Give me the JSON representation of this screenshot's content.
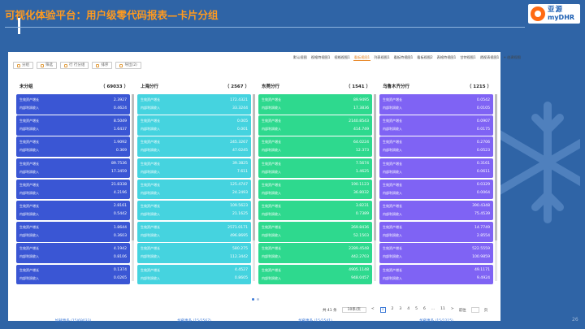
{
  "slide": {
    "title": "可视化体验平台：用户级零代码报表—卡片分组",
    "logo_cn": "亚源",
    "logo_en": "myDHR",
    "page_number": "26"
  },
  "toolbar": {
    "buttons": [
      "分组",
      "筛选",
      "行 行分组",
      "排序",
      "导出(2)"
    ]
  },
  "view_tabs": {
    "items": [
      "默认视图",
      "视格特视图1",
      "视格视图1",
      "看板视图1",
      "列表视图1",
      "看板特视图1",
      "看板视图2",
      "表格特视图1",
      "甘特视图1",
      "透视表视图1",
      "+ 创建视图"
    ],
    "active_index": 3
  },
  "card_labels": {
    "label1": "生效资产增长",
    "label2": "内部利润收入"
  },
  "columns": [
    {
      "title": "未分组",
      "count": "（ 69033 ）",
      "color": "#3a56d4",
      "load_more": "加载更多 (15/69033)",
      "cards": [
        [
          "2.3927",
          "0.4624"
        ],
        [
          "8.5049",
          "1.6437"
        ],
        [
          "1.9092",
          "0.369"
        ],
        [
          "89.7536",
          "17.3459"
        ],
        [
          "21.8338",
          "4.2196"
        ],
        [
          "2.8161",
          "0.5442"
        ],
        [
          "1.8644",
          "0.3603"
        ],
        [
          "4.1942",
          "0.8106"
        ],
        [
          "0.1374",
          "0.0265"
        ]
      ]
    },
    {
      "title": "上海分行",
      "count": "（ 2567 ）",
      "color": "#45d3df",
      "load_more": "加载更多 (15/2567)",
      "cards": [
        [
          "172.4321",
          "33.3244"
        ],
        [
          "0.005",
          "0.001"
        ],
        [
          "245.3267",
          "47.0245"
        ],
        [
          "39.3825",
          "7.611"
        ],
        [
          "125.4747",
          "24.2493"
        ],
        [
          "109.5623",
          "21.1625"
        ],
        [
          "2571.0171",
          "496.8695"
        ],
        [
          "580.275",
          "112.3442"
        ],
        [
          "4.4527",
          "0.8605"
        ]
      ]
    },
    {
      "title": "东莞分行",
      "count": "（ 1541 ）",
      "color": "#2ed98e",
      "load_more": "加载更多 (15/1541)",
      "cards": [
        [
          "89.9495",
          "17.3836"
        ],
        [
          "2140.8543",
          "414.749"
        ],
        [
          "64.0224",
          "12.373"
        ],
        [
          "7.5674",
          "1.4625"
        ],
        [
          "190.1123",
          "36.8032"
        ],
        [
          "3.8231",
          "0.7389"
        ],
        [
          "269.8436",
          "52.1503"
        ],
        [
          "2289.4548",
          "442.2703"
        ],
        [
          "4905.1148",
          "948.0457"
        ]
      ]
    },
    {
      "title": "乌鲁木齐分行",
      "count": "（ 1215 ）",
      "color": "#7f63f4",
      "load_more": "加载更多 (15/1215)",
      "cards": [
        [
          "0.0542",
          "0.0105"
        ],
        [
          "0.0907",
          "0.0175"
        ],
        [
          "0.2706",
          "0.0523"
        ],
        [
          "0.3161",
          "0.0611"
        ],
        [
          "0.0329",
          "0.0064"
        ],
        [
          "390.4348",
          "75.4539"
        ],
        [
          "14.7749",
          "2.8554"
        ],
        [
          "522.5559",
          "100.9859"
        ],
        [
          "49.1171",
          "9.4924"
        ]
      ]
    }
  ],
  "pagination": {
    "total": "共 41 条",
    "page_size": "10条/页",
    "pages": [
      "<",
      "1",
      "2",
      "3",
      "4",
      "5",
      "6",
      "...",
      "11",
      ">"
    ],
    "current_index": 1,
    "goto_label": "前往",
    "goto_suffix": "页"
  }
}
